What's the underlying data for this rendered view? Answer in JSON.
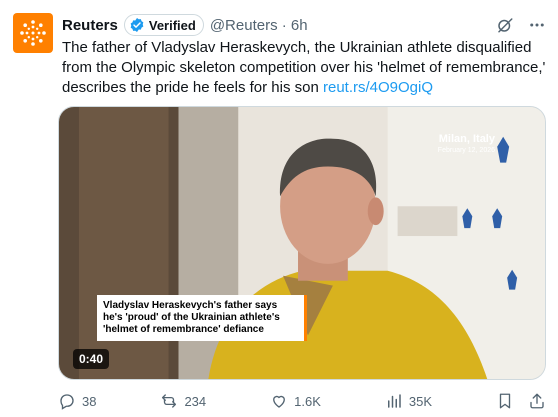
{
  "author": {
    "name": "Reuters",
    "verified_label": "Verified",
    "handle_time": "@Reuters · 6h"
  },
  "tweet": {
    "text": "The father of Vladyslav Heraskevych, the Ukrainian athlete disqualified from the Olympic skeleton competition over his 'helmet of remembrance,' describes the pride he feels for his son ",
    "link": "reut.rs/4O9OgiQ"
  },
  "media": {
    "location_city": "Milan, Italy",
    "location_date": "February 12, 2026",
    "caption": "Vladyslav Heraskevych's father says he's 'proud' of the Ukrainian athlete's 'helmet of remembrance' defiance",
    "duration": "0:40"
  },
  "actions": {
    "replies": "38",
    "reposts": "234",
    "likes": "1.6K",
    "views": "35K"
  },
  "colors": {
    "brand": "#ff8000",
    "link": "#1d9bf0",
    "verified": "#1d9bf0",
    "muted": "#536471"
  },
  "icons": [
    "reuters-logo",
    "verified-badge-icon",
    "grok-icon",
    "more-icon",
    "reply-icon",
    "repost-icon",
    "like-icon",
    "views-icon",
    "bookmark-icon",
    "share-icon"
  ]
}
